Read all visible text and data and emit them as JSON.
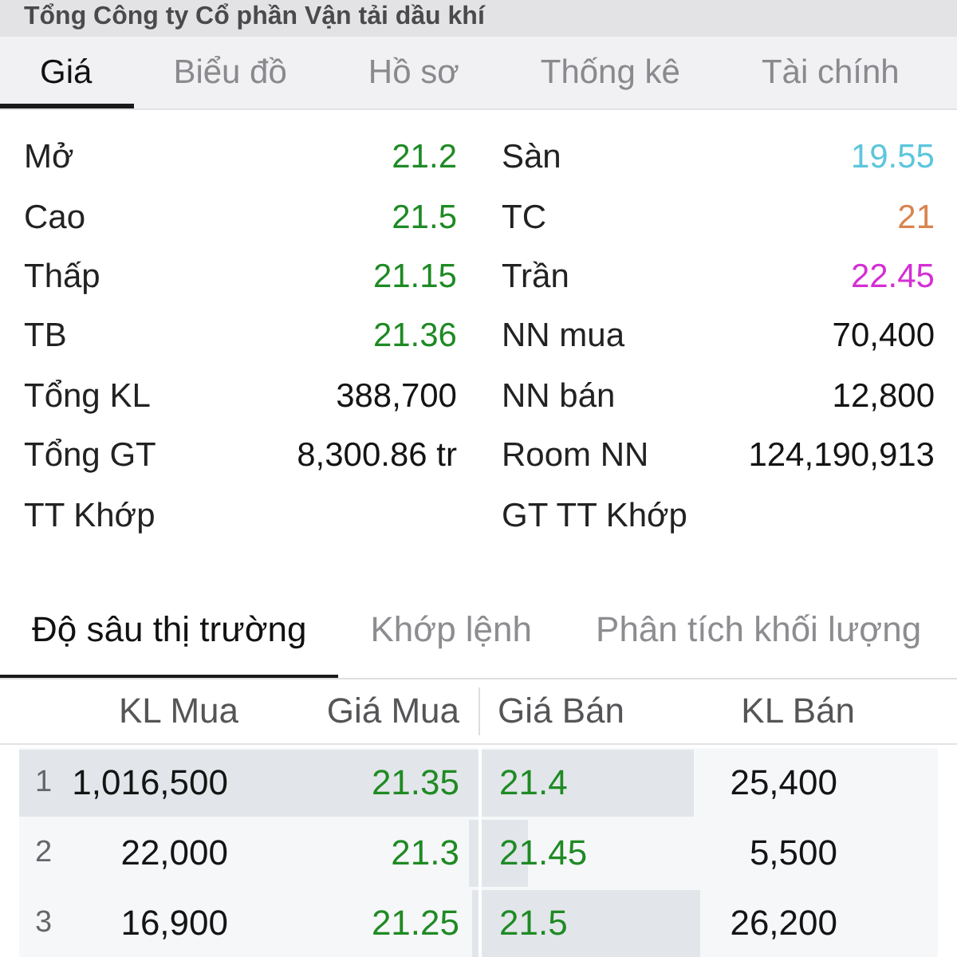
{
  "header": {
    "title": "Tổng Công ty Cổ phần Vận tải dầu khí"
  },
  "tabs": [
    {
      "label": "Giá",
      "selected": true
    },
    {
      "label": "Biểu đồ",
      "selected": false
    },
    {
      "label": "Hồ sơ",
      "selected": false
    },
    {
      "label": "Thống kê",
      "selected": false
    },
    {
      "label": "Tài chính",
      "selected": false
    }
  ],
  "stats": {
    "left": [
      {
        "label": "Mở",
        "value": "21.2",
        "color": "#1f8a24"
      },
      {
        "label": "Cao",
        "value": "21.5",
        "color": "#1f8a24"
      },
      {
        "label": "Thấp",
        "value": "21.15",
        "color": "#1f8a24"
      },
      {
        "label": "TB",
        "value": "21.36",
        "color": "#1f8a24"
      },
      {
        "label": "Tổng KL",
        "value": "388,700",
        "color": "#141414"
      },
      {
        "label": "Tổng GT",
        "value": "8,300.86 tr",
        "color": "#141414"
      },
      {
        "label": "TT Khớp"
      }
    ],
    "right": [
      {
        "label": "Sàn",
        "value": "19.55",
        "color": "#5cc6dc"
      },
      {
        "label": "TC",
        "value": "21",
        "color": "#d9844f"
      },
      {
        "label": "Trần",
        "value": "22.45",
        "color": "#d42fd4"
      },
      {
        "label": "NN mua",
        "value": "70,400",
        "color": "#141414"
      },
      {
        "label": "NN bán",
        "value": "12,800",
        "color": "#141414"
      },
      {
        "label": "Room NN",
        "value": "124,190,913",
        "color": "#141414"
      },
      {
        "label": "GT TT Khớp"
      }
    ]
  },
  "depth_tabs": [
    {
      "label": "Độ sâu thị trường",
      "selected": true
    },
    {
      "label": "Khớp lệnh",
      "selected": false
    },
    {
      "label": "Phân tích khối lượng",
      "selected": false
    }
  ],
  "order_book": {
    "columns": [
      "KL Mua",
      "Giá Mua",
      "Giá Bán",
      "KL Bán"
    ],
    "rows": [
      {
        "index": "1",
        "bid": {
          "volume": "1,016,500",
          "price": "21.35",
          "level": 1
        },
        "ask": {
          "price": "21.4",
          "volume": "25,400",
          "level": 0.465
        }
      },
      {
        "index": "2",
        "bid": {
          "volume": "22,000",
          "price": "21.3",
          "level": 0.022
        },
        "ask": {
          "price": "21.45",
          "volume": "5,500",
          "level": 0.1
        }
      },
      {
        "index": "3",
        "bid": {
          "volume": "16,900",
          "price": "21.25",
          "level": 0.015
        },
        "ask": {
          "price": "21.5",
          "volume": "26,200",
          "level": 0.48
        }
      }
    ]
  }
}
